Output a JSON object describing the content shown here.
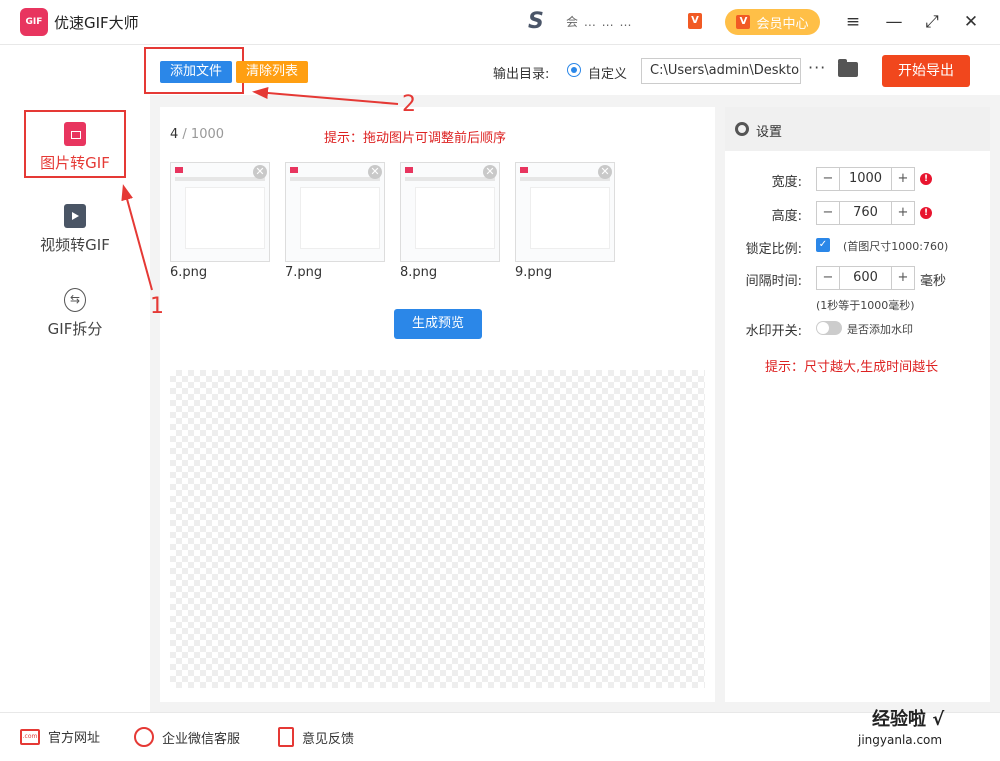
{
  "app": {
    "title": "优速GIF大师",
    "logo_text": "GIF"
  },
  "promo": {
    "letter": "S",
    "text": "会 … … …",
    "badge": "V"
  },
  "vip": {
    "label": "会员中心",
    "badge": "V"
  },
  "window_controls": {
    "menu": "≡",
    "minimize": "—",
    "maximize": "⤢",
    "close": "✕"
  },
  "sidebar": {
    "items": [
      {
        "label": "图片转GIF",
        "icon": "image-file-icon"
      },
      {
        "label": "视频转GIF",
        "icon": "video-file-icon"
      },
      {
        "label": "GIF拆分",
        "icon": "split-icon"
      }
    ]
  },
  "toolbar": {
    "add_label": "添加文件",
    "clear_label": "清除列表",
    "output_label": "输出目录:",
    "custom_label": "自定义",
    "path_value": "C:\\Users\\admin\\Deskto",
    "more": "···",
    "export_label": "开始导出"
  },
  "main": {
    "count_current": "4",
    "count_total": " / 1000",
    "tip": "提示：拖动图片可调整前后顺序",
    "thumbnails": [
      {
        "name": "6.png"
      },
      {
        "name": "7.png"
      },
      {
        "name": "8.png"
      },
      {
        "name": "9.png"
      }
    ],
    "preview_label": "生成预览"
  },
  "settings": {
    "title": "设置",
    "width_label": "宽度:",
    "width_value": "1000",
    "height_label": "高度:",
    "height_value": "760",
    "lock_label": "锁定比例:",
    "lock_hint": "(首图尺寸1000:760)",
    "interval_label": "间隔时间:",
    "interval_value": "600",
    "interval_unit": "毫秒",
    "interval_hint": "(1秒等于1000毫秒)",
    "watermark_label": "水印开关:",
    "watermark_hint": "是否添加水印",
    "tip": "提示：尺寸越大,生成时间越长"
  },
  "footer": {
    "website": "官方网址",
    "wechat": "企业微信客服",
    "feedback": "意见反馈"
  },
  "annotations": {
    "one": "1",
    "two": "2"
  },
  "watermark": {
    "brand": "经验啦 √",
    "url": "jingyanla.com"
  },
  "colors": {
    "accent_blue": "#2b87e8",
    "orange": "#ff9f12",
    "export_red": "#f1471d",
    "highlight_red": "#e53935",
    "brand_pink": "#e8355f"
  }
}
